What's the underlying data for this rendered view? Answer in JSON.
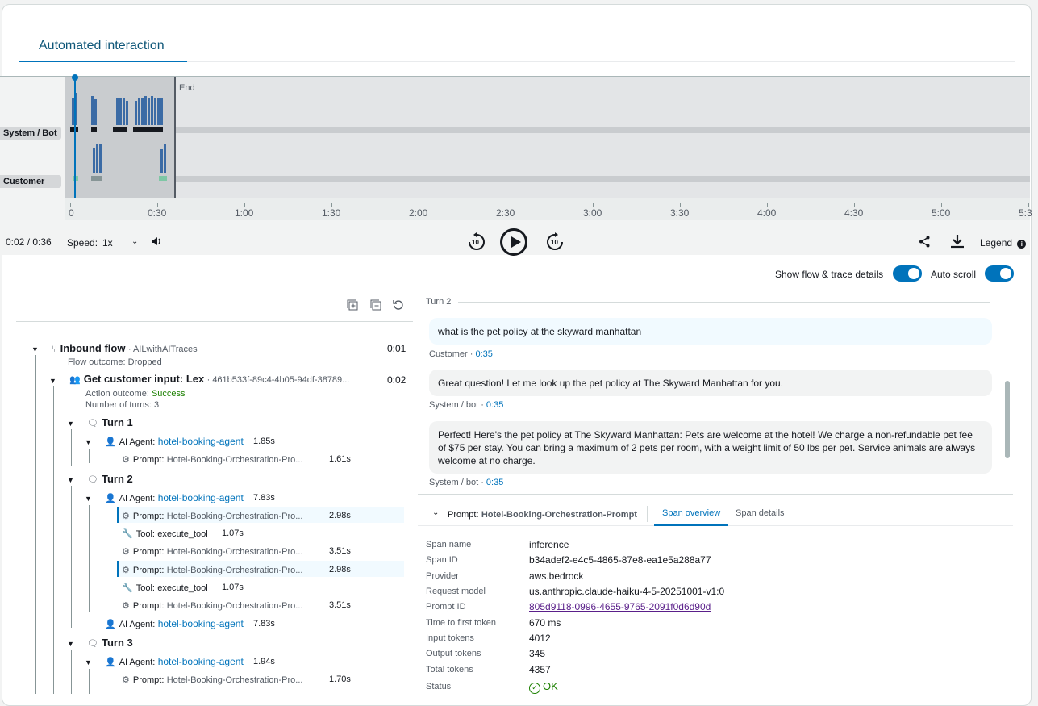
{
  "tabs": [
    {
      "label": "Automated interaction"
    }
  ],
  "timeline": {
    "end_label": "End",
    "lanes": [
      "System / Bot",
      "Customer"
    ],
    "ticks": [
      "0",
      "0:30",
      "1:00",
      "1:30",
      "2:00",
      "2:30",
      "3:00",
      "3:30",
      "4:00",
      "4:30",
      "5:00",
      "5:3"
    ]
  },
  "player": {
    "time": "0:02 / 0:36",
    "speed_label": "Speed:",
    "speed_value": "1x",
    "legend_label": "Legend",
    "rewind_label": "10",
    "forward_label": "10"
  },
  "toggles": [
    {
      "label": "Show flow & trace details",
      "on": true
    },
    {
      "label": "Auto scroll",
      "on": true
    }
  ],
  "tree": {
    "inbound_flow": {
      "label": "Inbound flow",
      "link": "AILwithAITraces",
      "duration": "0:01",
      "outcome": "Flow outcome: Dropped"
    },
    "get_input": {
      "label": "Get customer input: Lex",
      "link": "461b533f-89c4-4b05-94df-38789...",
      "duration": "0:02",
      "action_prefix": "Action outcome: ",
      "action_value": "Success",
      "turns": "Number of turns: 3"
    },
    "turn1": {
      "label": "Turn 1"
    },
    "turn2": {
      "label": "Turn 2"
    },
    "turn3": {
      "label": "Turn 3"
    },
    "agent_label": "AI Agent:",
    "agent_name": "hotel-booking-agent",
    "prompt_label": "Prompt:",
    "prompt_name": "Hotel-Booking-Orchestration-Pro...",
    "tool_label": "Tool:",
    "tool_name": "execute_tool",
    "t1_agent_dur": "1.85s",
    "t1_prompt_dur": "1.61s",
    "t2_agent_dur": "7.83s",
    "t2_p1_dur": "2.98s",
    "t2_tool1_dur": "1.07s",
    "t2_p2_dur": "3.51s",
    "t2_p3_dur": "2.98s",
    "t2_tool2_dur": "1.07s",
    "t2_p4_dur": "3.51s",
    "t2_agent2_dur": "7.83s",
    "t3_agent_dur": "1.94s",
    "t3_prompt_dur": "1.70s"
  },
  "chat": {
    "turn_label": "Turn 2",
    "messages": [
      {
        "text": "what is the pet policy at the skyward manhattan",
        "who": "Customer",
        "time": "0:35"
      },
      {
        "text": "Great question! Let me look up the pet policy at The Skyward Manhattan for you.",
        "who": "System / bot",
        "time": "0:35"
      },
      {
        "text": "Perfect! Here's the pet policy at The Skyward Manhattan: Pets are welcome at the hotel! We charge a non-refundable pet fee of $75 per stay. You can bring a maximum of 2 pets per room, with a weight limit of 50 lbs per pet. Service animals are always welcome at no charge.",
        "who": "System / bot",
        "time": "0:35"
      }
    ]
  },
  "detail": {
    "prompt_label": "Prompt:",
    "prompt_name": "Hotel-Booking-Orchestration-Prompt",
    "tabs": [
      "Span overview",
      "Span details"
    ],
    "rows": [
      {
        "k": "Span name",
        "v": "inference"
      },
      {
        "k": "Span ID",
        "v": "b34adef2-e4c5-4865-87e8-ea1e5a288a77"
      },
      {
        "k": "Provider",
        "v": "aws.bedrock"
      },
      {
        "k": "Request model",
        "v": "us.anthropic.claude-haiku-4-5-20251001-v1:0"
      },
      {
        "k": "Prompt ID",
        "v": "805d9118-0996-4655-9765-2091f0d6d90d"
      },
      {
        "k": "Time to first token",
        "v": "670 ms"
      },
      {
        "k": "Input tokens",
        "v": "4012"
      },
      {
        "k": "Output tokens",
        "v": "345"
      },
      {
        "k": "Total tokens",
        "v": "4357"
      },
      {
        "k": "Status",
        "v": "OK"
      }
    ]
  },
  "colors": {
    "accent": "#0073bb",
    "success": "#1d8102",
    "link_visited": "#5a1f8a"
  }
}
